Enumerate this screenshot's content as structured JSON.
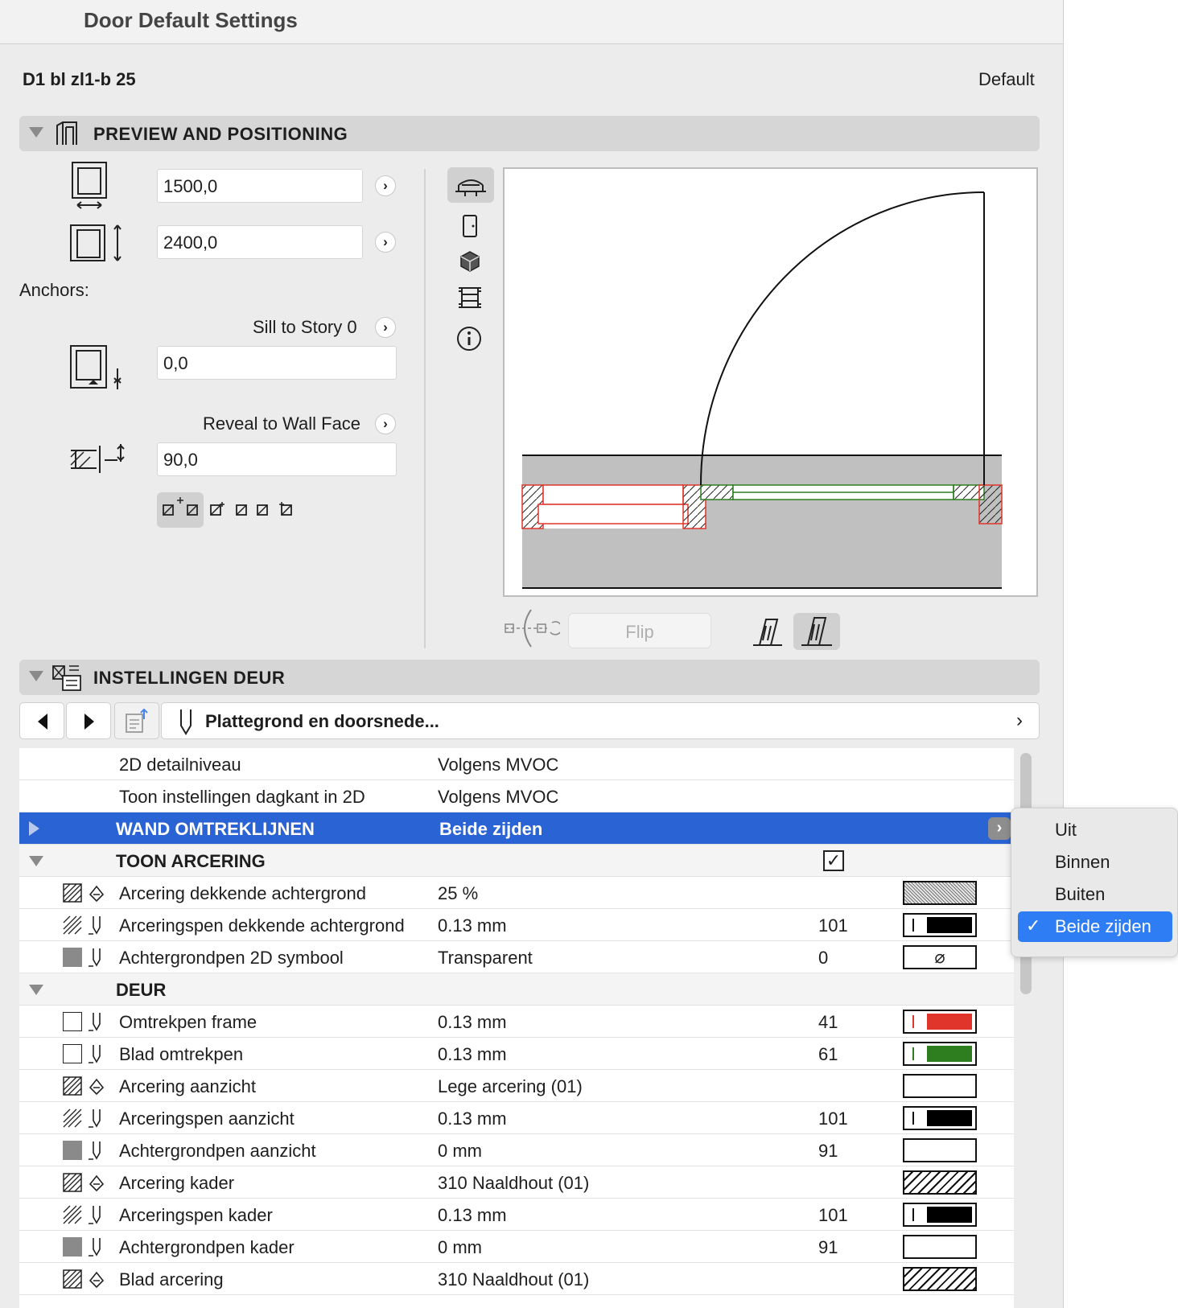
{
  "window": {
    "title": "Door Default Settings"
  },
  "header": {
    "element_id": "D1 bl zl1-b 25",
    "favorite": "Default"
  },
  "preview_section": {
    "title": "PREVIEW AND POSITIONING",
    "width_value": "1500,0",
    "height_value": "2400,0",
    "anchors_label": "Anchors:",
    "sill_label": "Sill to Story 0",
    "sill_value": "0,0",
    "reveal_label": "Reveal to Wall Face",
    "reveal_value": "90,0",
    "flip_label": "Flip"
  },
  "settings_section": {
    "title": "INSTELLINGEN DEUR",
    "page_label": "Plattegrond en doorsnede...",
    "rows": [
      {
        "name": "2D detailniveau",
        "value": "Volgens MVOC"
      },
      {
        "name": "Toon instellingen dagkant in 2D",
        "value": "Volgens MVOC"
      },
      {
        "name": "WAND OMTREKLIJNEN",
        "value": "Beide zijden"
      },
      {
        "name": "TOON ARCERING",
        "value": ""
      },
      {
        "name": "Arcering dekkende achtergrond",
        "value": "25 %",
        "num": ""
      },
      {
        "name": "Arceringspen dekkende achtergrond",
        "value": "0.13 mm",
        "num": "101"
      },
      {
        "name": "Achtergrondpen 2D symbool",
        "value": "Transparent",
        "num": "0"
      },
      {
        "name": "DEUR",
        "value": ""
      },
      {
        "name": "Omtrekpen frame",
        "value": "0.13 mm",
        "num": "41"
      },
      {
        "name": "Blad omtrekpen",
        "value": "0.13 mm",
        "num": "61"
      },
      {
        "name": "Arcering aanzicht",
        "value": "Lege arcering (01)",
        "num": ""
      },
      {
        "name": "Arceringspen aanzicht",
        "value": "0.13 mm",
        "num": "101"
      },
      {
        "name": "Achtergrondpen aanzicht",
        "value": "0 mm",
        "num": "91"
      },
      {
        "name": "Arcering kader",
        "value": "310 Naaldhout (01)",
        "num": ""
      },
      {
        "name": "Arceringspen kader",
        "value": "0.13 mm",
        "num": "101"
      },
      {
        "name": "Achtergrondpen kader",
        "value": "0 mm",
        "num": "91"
      },
      {
        "name": "Blad arcering",
        "value": "310 Naaldhout (01)",
        "num": ""
      }
    ],
    "show_hatch_checked": true,
    "colors": {
      "selection": "#2a63d4",
      "frame_pen": "#e0352b",
      "leaf_pen": "#2e7d1f"
    }
  },
  "dropdown": {
    "options": [
      "Uit",
      "Binnen",
      "Buiten",
      "Beide zijden"
    ],
    "selected": "Beide zijden"
  }
}
